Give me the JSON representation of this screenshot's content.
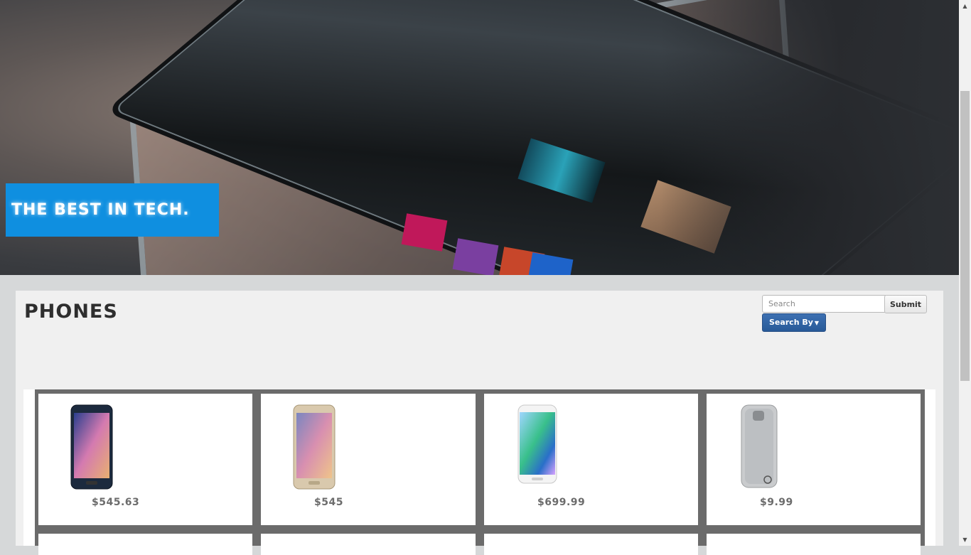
{
  "hero": {
    "tagline": "THE BEST IN TECH."
  },
  "page": {
    "title": "PHONES"
  },
  "search": {
    "placeholder": "Search",
    "submit_label": "Submit",
    "search_by_label": "Search By"
  },
  "products": [
    {
      "price": "$545.63",
      "image": "black-smartphone-image"
    },
    {
      "price": "$545",
      "image": "gold-smartphone-image"
    },
    {
      "price": "$699.99",
      "image": "white-edge-smartphone-image"
    },
    {
      "price": "$9.99",
      "image": "clear-phone-case-image"
    }
  ],
  "colors": {
    "tagline_bg": "#0f8fe0",
    "primary_button": "#2d5f9e",
    "card_frame": "#6b6b6b"
  }
}
